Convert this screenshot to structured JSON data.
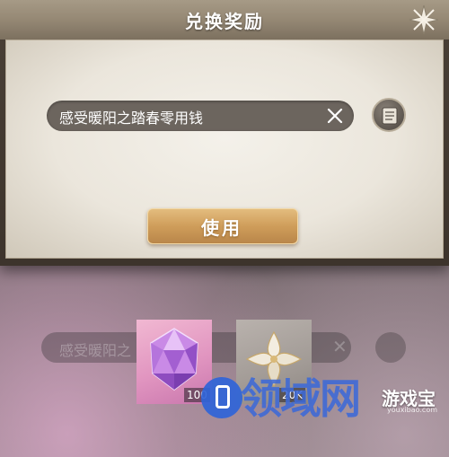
{
  "dialog": {
    "title": "兑换奖励",
    "code_input": {
      "value": "感受暖阳之踏春零用钱"
    },
    "use_button_label": "使用"
  },
  "rewards": [
    {
      "icon": "purple-gem-icon",
      "quantity": "100"
    },
    {
      "icon": "silver-flower-icon",
      "quantity": "20K"
    }
  ],
  "background_ghost": {
    "code_text": "感受暖阳之"
  },
  "watermark": {
    "big_text": "领域网",
    "small_text": "游戏宝",
    "domain": "youxibao.com"
  },
  "colors": {
    "title_bar": "#958874",
    "button_gold": "#cf9d5a",
    "input_bg": "#6c655e",
    "watermark_blue": "#2f64d8"
  }
}
